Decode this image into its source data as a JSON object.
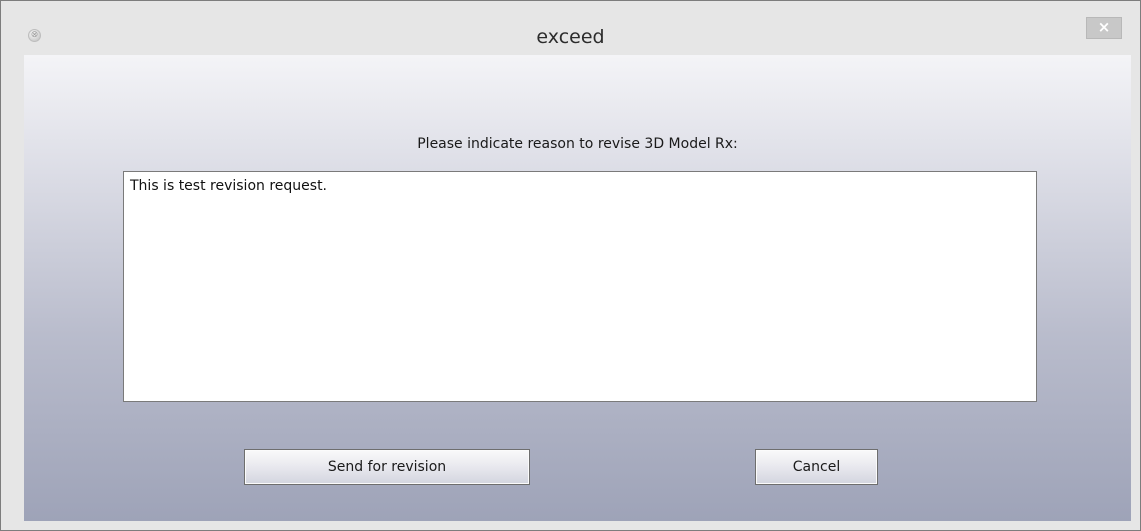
{
  "window": {
    "title": "exceed",
    "app_icon": "app-icon",
    "close_label": "×"
  },
  "dialog": {
    "prompt": "Please indicate reason to revise 3D Model Rx:",
    "reason_value": "This is test revision request.",
    "buttons": {
      "send_label": "Send for revision",
      "cancel_label": "Cancel"
    }
  }
}
